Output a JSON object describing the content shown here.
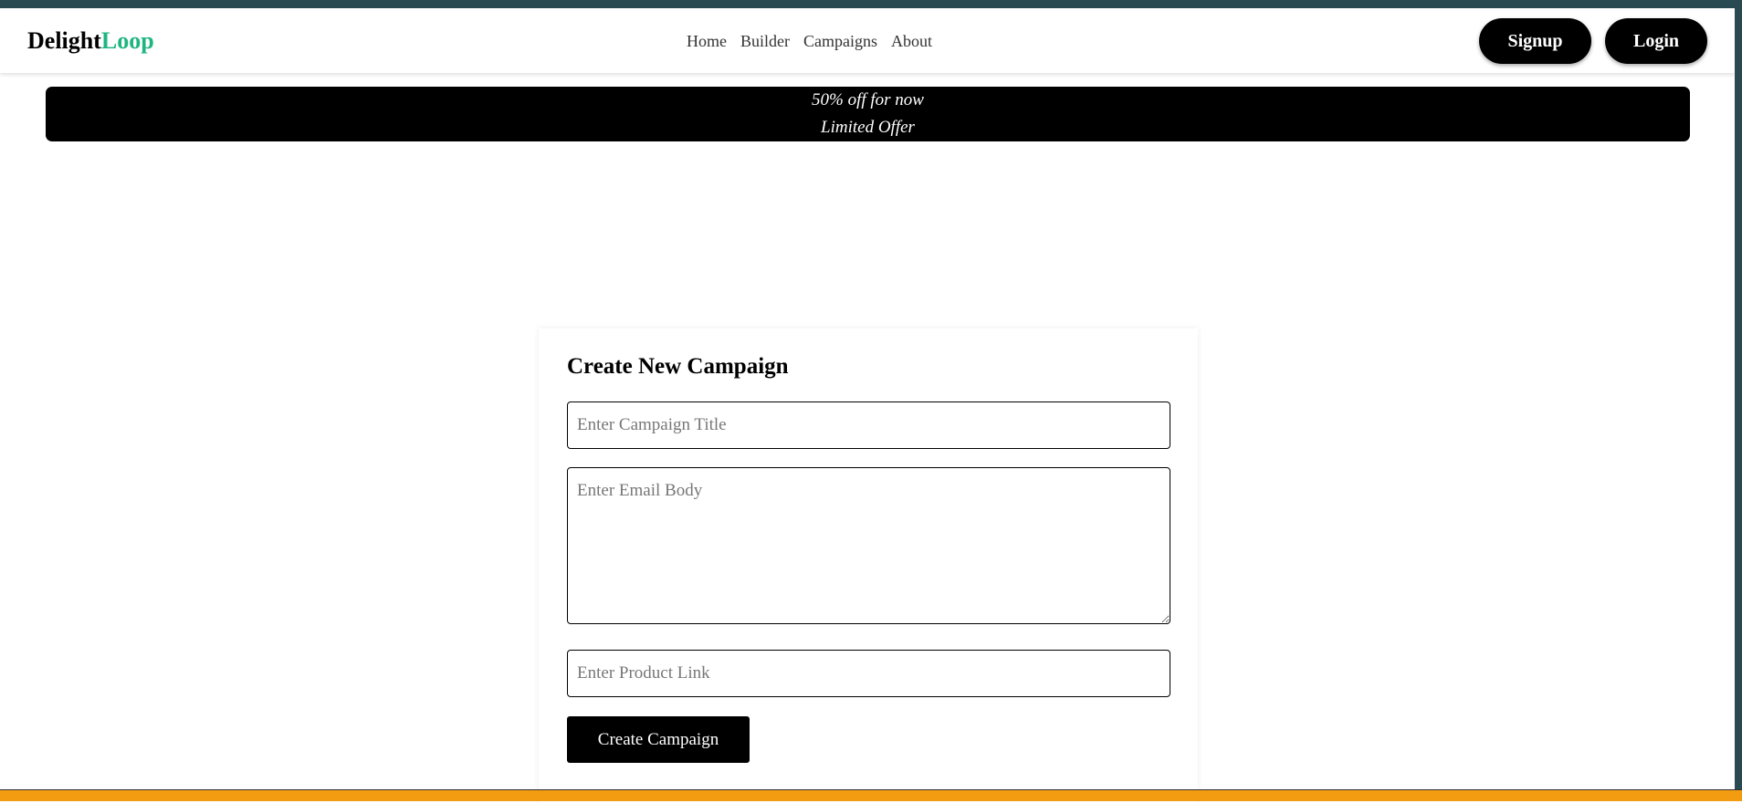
{
  "brand": {
    "name_part1": "Delight",
    "name_part2": "Loop",
    "accent_color": "#1fb580"
  },
  "nav": {
    "links": [
      "Home",
      "Builder",
      "Campaigns",
      "About"
    ],
    "signup_label": "Signup",
    "login_label": "Login"
  },
  "promo": {
    "line1": "50% off for now",
    "line2": "Limited Offer"
  },
  "form": {
    "heading": "Create New Campaign",
    "title_placeholder": "Enter Campaign Title",
    "title_value": "",
    "body_placeholder": "Enter Email Body",
    "body_value": "",
    "link_placeholder": "Enter Product Link",
    "link_value": "",
    "submit_label": "Create Campaign"
  },
  "colors": {
    "bottom_bar": "#f39c12",
    "top_strip": "#2a4a52"
  }
}
